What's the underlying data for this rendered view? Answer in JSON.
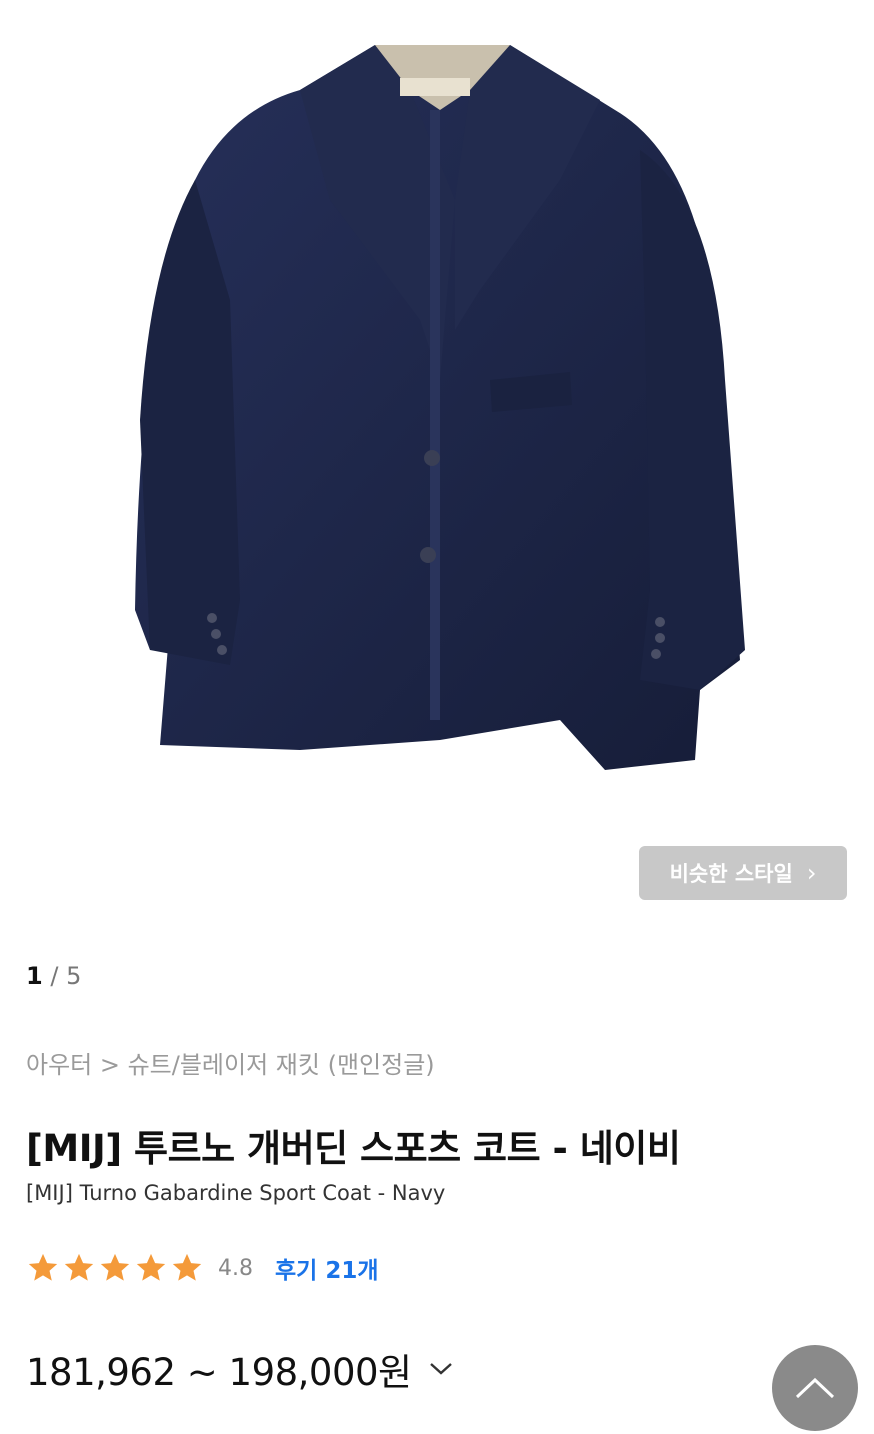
{
  "product": {
    "image_alt": "navy sport coat photo",
    "similar_style_label": "비슷한 스타일",
    "pager": {
      "current": "1",
      "separator": "/",
      "total": "5"
    },
    "breadcrumb": "아우터 > 슈트/블레이저 재킷 (맨인정글)",
    "title_ko": "[MIJ] 투르노 개버딘 스포츠 코트 - 네이비",
    "title_en": "[MIJ] Turno Gabardine Sport Coat - Navy",
    "rating": {
      "stars": 5,
      "value": "4.8",
      "reviews_label": "후기 21개"
    },
    "price_range": "181,962 ~ 198,000원"
  },
  "icons": {
    "star": "star-icon",
    "chevron_right": "chevron-right-icon",
    "chevron_down": "chevron-down-icon",
    "scroll_top": "chevron-up-icon"
  },
  "colors": {
    "coat": "#1f2744",
    "star": "#f49a3a",
    "review_link": "#1a73e8",
    "similar_btn_bg": "#c8c8c8",
    "top_btn_bg": "#8a8a8a"
  }
}
